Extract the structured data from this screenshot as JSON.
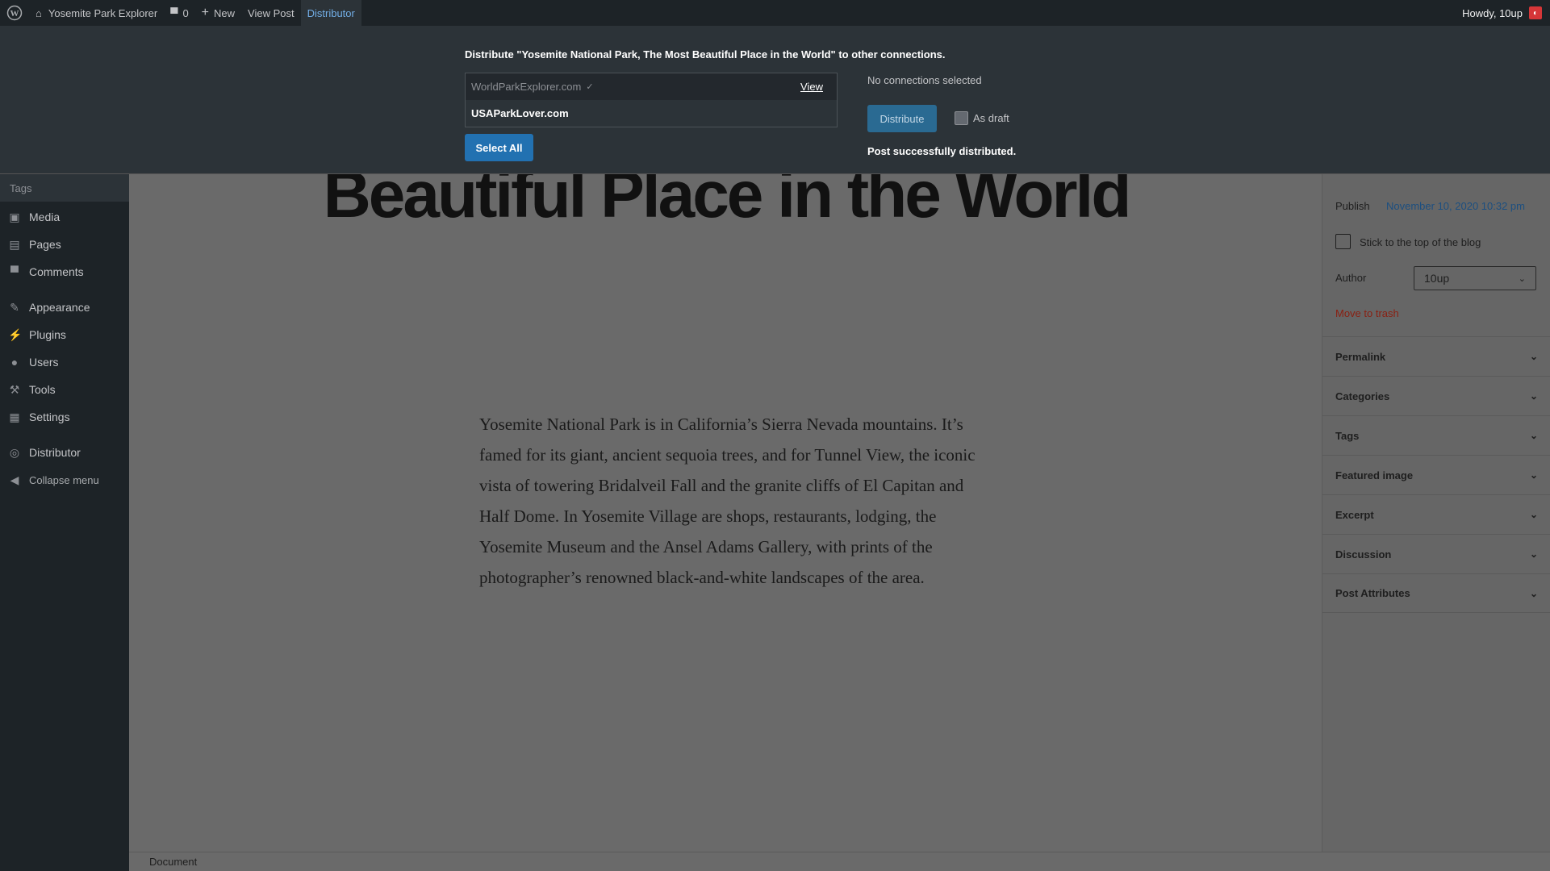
{
  "adminbar": {
    "site_name": "Yosemite Park Explorer",
    "comments_count": "0",
    "new_label": "New",
    "view_post_label": "View Post",
    "distributor_label": "Distributor",
    "howdy": "Howdy, 10up"
  },
  "distributor": {
    "heading": "Distribute \"Yosemite National Park, The Most Beautiful Place in the World\" to other connections.",
    "connections": [
      {
        "name": "WorldParkExplorer.com",
        "view_label": "View"
      },
      {
        "name": "USAParkLover.com"
      }
    ],
    "select_all_label": "Select All",
    "no_connections": "No connections selected",
    "distribute_label": "Distribute",
    "as_draft_label": "As draft",
    "success_message": "Post successfully distributed."
  },
  "menu": {
    "tags_label": "Tags",
    "items": [
      {
        "label": "Media",
        "icon": "media-icon"
      },
      {
        "label": "Pages",
        "icon": "pages-icon"
      },
      {
        "label": "Comments",
        "icon": "comments-icon"
      },
      {
        "label": "Appearance",
        "icon": "appearance-icon"
      },
      {
        "label": "Plugins",
        "icon": "plugins-icon"
      },
      {
        "label": "Users",
        "icon": "users-icon"
      },
      {
        "label": "Tools",
        "icon": "tools-icon"
      },
      {
        "label": "Settings",
        "icon": "settings-icon"
      },
      {
        "label": "Distributor",
        "icon": "distributor-icon"
      },
      {
        "label": "Collapse menu",
        "icon": "collapse-icon"
      }
    ]
  },
  "post": {
    "title": "Yosemite National Park, The Most Beautiful Place in the World",
    "body": "Yosemite National Park is in California’s Sierra Nevada mountains. It’s famed for its giant, ancient sequoia trees, and for Tunnel View, the iconic vista of towering Bridalveil Fall and the granite cliffs of El Capitan and Half Dome. In Yosemite Village are shops, restaurants, lodging, the Yosemite Museum and the Ansel Adams Gallery, with prints of the photographer’s renowned black-and-white landscapes of the area."
  },
  "sidebar": {
    "publish_label": "Publish",
    "publish_date": "November 10, 2020 10:32 pm",
    "sticky_label": "Stick to the top of the blog",
    "author_label": "Author",
    "author_value": "10up",
    "trash_label": "Move to trash",
    "panels": [
      "Permalink",
      "Categories",
      "Tags",
      "Featured image",
      "Excerpt",
      "Discussion",
      "Post Attributes"
    ]
  },
  "footer": {
    "breadcrumb": "Document"
  },
  "colors": {
    "accent": "#2271b1",
    "active_link": "#72aee6",
    "trash": "#8a1f11"
  }
}
